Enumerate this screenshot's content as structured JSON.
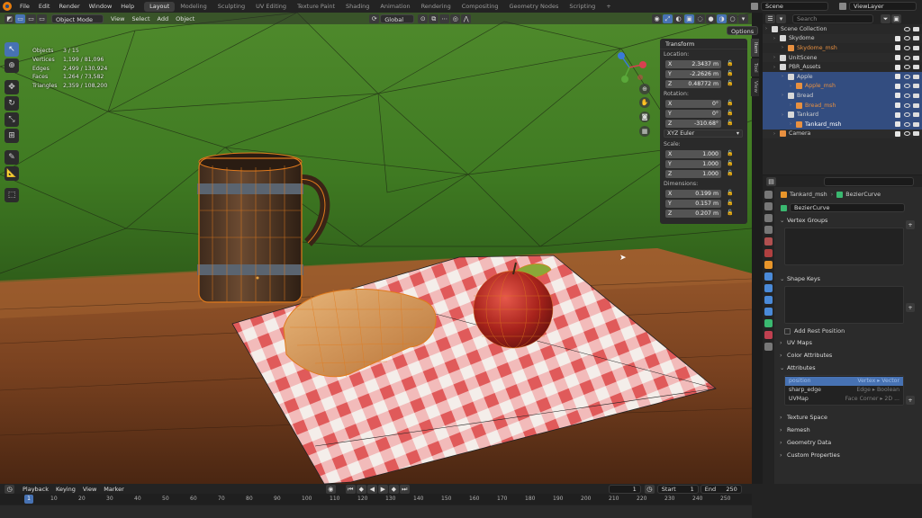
{
  "menubar": {
    "items": [
      "File",
      "Edit",
      "Render",
      "Window",
      "Help"
    ],
    "tabs": [
      "Layout",
      "Modeling",
      "Sculpting",
      "UV Editing",
      "Texture Paint",
      "Shading",
      "Animation",
      "Rendering",
      "Compositing",
      "Geometry Nodes",
      "Scripting"
    ],
    "add_tab": "+",
    "scene_label": "Scene",
    "view_layer_label": "ViewLayer"
  },
  "viewport_header": {
    "mode": "Object Mode",
    "menus": [
      "View",
      "Select",
      "Add",
      "Object"
    ],
    "orientation": "Global",
    "options": "Options"
  },
  "stats": [
    {
      "k": "Objects",
      "v": "3 / 15"
    },
    {
      "k": "Vertices",
      "v": "1,199 / 81,096"
    },
    {
      "k": "Edges",
      "v": "2,499 / 130,924"
    },
    {
      "k": "Faces",
      "v": "1,264 / 73,582"
    },
    {
      "k": "Triangles",
      "v": "2,359 / 108,200"
    }
  ],
  "transform": {
    "title": "Transform",
    "location_label": "Location:",
    "location": [
      {
        "axis": "X",
        "value": "2.3437 m"
      },
      {
        "axis": "Y",
        "value": "-2.2626 m"
      },
      {
        "axis": "Z",
        "value": "0.48772 m"
      }
    ],
    "rotation_label": "Rotation:",
    "rotation": [
      {
        "axis": "X",
        "value": "0°"
      },
      {
        "axis": "Y",
        "value": "0°"
      },
      {
        "axis": "Z",
        "value": "-310.68°"
      }
    ],
    "rotation_mode": "XYZ Euler",
    "scale_label": "Scale:",
    "scale": [
      {
        "axis": "X",
        "value": "1.000"
      },
      {
        "axis": "Y",
        "value": "1.000"
      },
      {
        "axis": "Z",
        "value": "1.000"
      }
    ],
    "dimensions_label": "Dimensions:",
    "dimensions": [
      {
        "axis": "X",
        "value": "0.199 m"
      },
      {
        "axis": "Y",
        "value": "0.157 m"
      },
      {
        "axis": "Z",
        "value": "0.207 m"
      }
    ]
  },
  "side_tabs": [
    "Item",
    "Tool",
    "View"
  ],
  "outliner": {
    "search_placeholder": "Search",
    "rows": [
      {
        "label": "Scene Collection",
        "sub": "",
        "indent": 0,
        "icon": "collection-icon",
        "color": "#cfcfcf",
        "sel": false
      },
      {
        "label": "Skydome",
        "sub": "",
        "indent": 1,
        "icon": "collection-icon",
        "color": "#cfcfcf",
        "sel": false
      },
      {
        "label": "Skydome_msh",
        "sub": "",
        "indent": 2,
        "icon": "mesh-icon",
        "color": "#e89040",
        "sel": false
      },
      {
        "label": "UnitScene",
        "sub": "",
        "indent": 1,
        "icon": "collection-icon",
        "color": "#cfcfcf",
        "sel": false
      },
      {
        "label": "PBR_Assets",
        "sub": "",
        "indent": 1,
        "icon": "collection-icon",
        "color": "#cfcfcf",
        "sel": false
      },
      {
        "label": "Apple",
        "sub": "",
        "indent": 2,
        "icon": "collection-icon",
        "color": "#cfcfcf",
        "sel": true
      },
      {
        "label": "Apple_msh",
        "sub": "",
        "indent": 3,
        "icon": "mesh-icon",
        "color": "#e89040",
        "sel": true
      },
      {
        "label": "Bread",
        "sub": "",
        "indent": 2,
        "icon": "collection-icon",
        "color": "#cfcfcf",
        "sel": true
      },
      {
        "label": "Bread_msh",
        "sub": "",
        "indent": 3,
        "icon": "mesh-icon",
        "color": "#e89040",
        "sel": true
      },
      {
        "label": "Tankard",
        "sub": "",
        "indent": 2,
        "icon": "collection-icon",
        "color": "#cfcfcf",
        "sel": true
      },
      {
        "label": "Tankard_msh",
        "sub": "",
        "indent": 3,
        "icon": "mesh-icon",
        "color": "#ffffff",
        "sel": true
      },
      {
        "label": "Camera",
        "sub": "",
        "indent": 1,
        "icon": "camera-icon",
        "color": "#cfcfcf",
        "sel": false
      }
    ]
  },
  "properties": {
    "search_placeholder": "",
    "breadcrumb_object": "Tankard_msh",
    "breadcrumb_data": "BezierCurve",
    "datablock_name": "BezierCurve",
    "sections": {
      "vertex_groups": "Vertex Groups",
      "shape_keys": "Shape Keys",
      "add_rest_position": "Add Rest Position",
      "uv_maps": "UV Maps",
      "color_attributes": "Color Attributes",
      "attributes": "Attributes",
      "texture_space": "Texture Space",
      "remesh": "Remesh",
      "geometry_data": "Geometry Data",
      "custom_properties": "Custom Properties"
    },
    "attributes": [
      {
        "name": "position",
        "domain": "Vertex ▸ Vector",
        "hl": true
      },
      {
        "name": "sharp_edge",
        "domain": "Edge ▸ Boolean",
        "hl": false
      },
      {
        "name": "UVMap",
        "domain": "Face Corner ▸ 2D ...",
        "hl": false
      }
    ]
  },
  "timeline": {
    "menus": [
      "Playback",
      "Keying",
      "View",
      "Marker"
    ],
    "current_frame": "1",
    "start_label": "Start",
    "start": "1",
    "end_label": "End",
    "end": "250",
    "ticks": [
      "10",
      "20",
      "30",
      "40",
      "50",
      "60",
      "70",
      "80",
      "90",
      "100",
      "110",
      "120",
      "130",
      "140",
      "150",
      "160",
      "170",
      "180",
      "190",
      "200",
      "210",
      "220",
      "230",
      "240",
      "250"
    ],
    "playhead": "1"
  }
}
